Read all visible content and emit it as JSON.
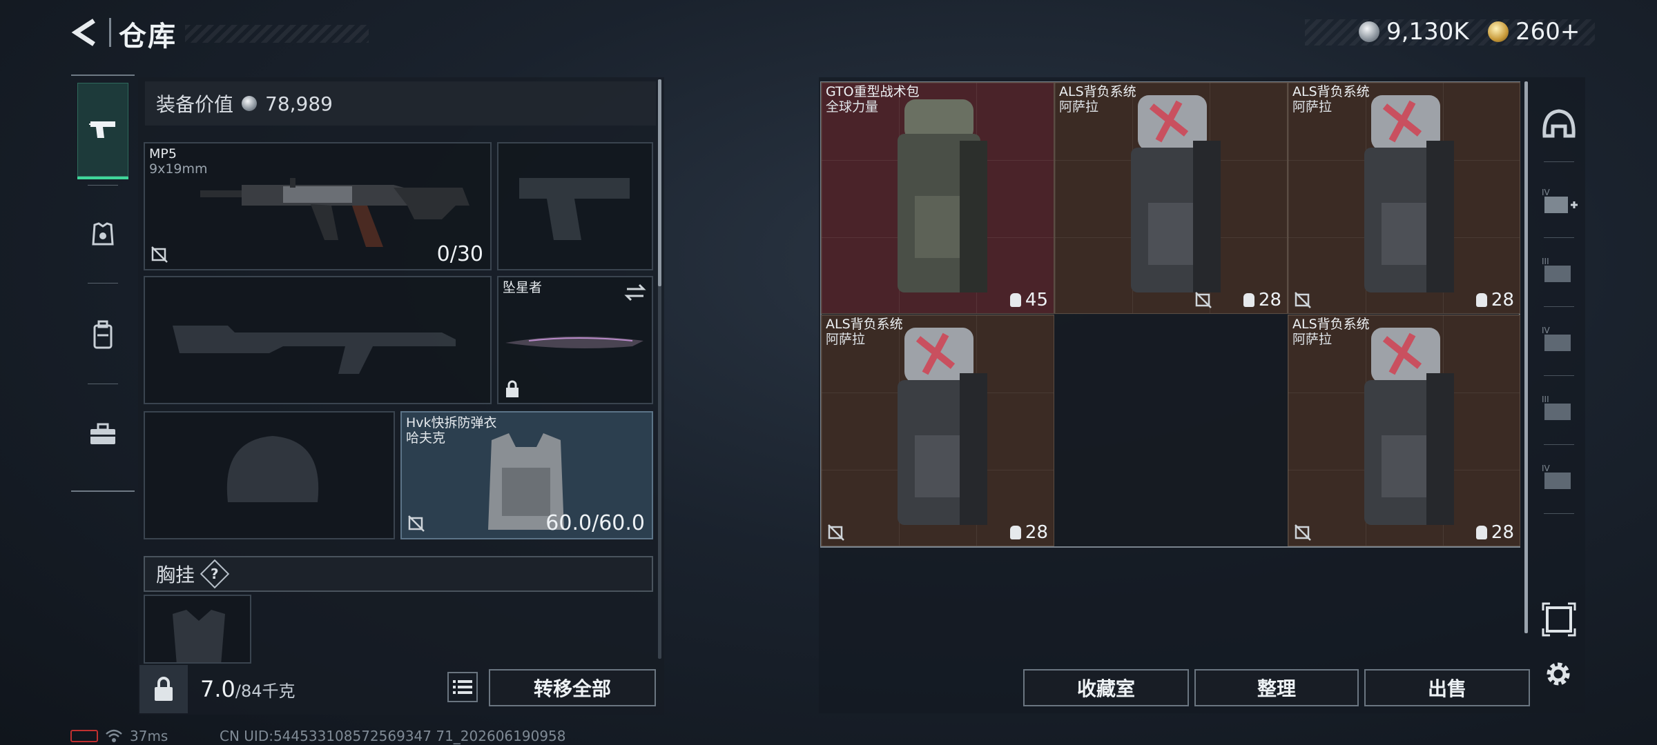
{
  "header": {
    "title": "仓库",
    "currency_primary": "9,130K",
    "currency_secondary": "260+"
  },
  "left_tabs": [
    {
      "name": "weapons",
      "icon": "pistol-icon",
      "active": true
    },
    {
      "name": "armor",
      "icon": "armor-plate-icon",
      "active": false
    },
    {
      "name": "backpack",
      "icon": "backpack-icon",
      "active": false
    },
    {
      "name": "case",
      "icon": "briefcase-icon",
      "active": false
    }
  ],
  "equipment": {
    "value_label": "装备价值",
    "value": "78,989",
    "primary_weapon": {
      "name": "MP5",
      "caliber": "9x19mm",
      "ammo": "0/30"
    },
    "melee": {
      "name": "坠星者"
    },
    "armor": {
      "name": "Hvk快拆防弹衣",
      "maker": "哈夫克",
      "durability": "60.0/60.0"
    },
    "chest_rig_label": "胸挂",
    "chest_rig_help": "?"
  },
  "footer_left": {
    "weight": "7.0",
    "weight_cap": "/84千克",
    "transfer_all": "转移全部"
  },
  "status": {
    "ping": "37ms",
    "uid": "CN UID:544533108572569347 71_202606190958"
  },
  "stash": {
    "items": [
      {
        "name": "GTO重型战术包",
        "maker": "全球力量",
        "capacity": "45",
        "tint": "red",
        "insured": true
      },
      {
        "name": "ALS背负系统",
        "maker": "阿萨拉",
        "capacity": "28",
        "tint": "brown",
        "insured": false
      },
      {
        "name": "ALS背负系统",
        "maker": "阿萨拉",
        "capacity": "28",
        "tint": "brown",
        "insured": false
      },
      {
        "name": "ALS背负系统",
        "maker": "阿萨拉",
        "capacity": "28",
        "tint": "brown",
        "insured": false
      },
      {
        "name": "ALS背负系统",
        "maker": "阿萨拉",
        "capacity": "28",
        "tint": "brown",
        "insured": false
      }
    ]
  },
  "buttons": {
    "collection": "收藏室",
    "sort": "整理",
    "sell": "出售"
  },
  "right_tabs": [
    "helmet-icon",
    "add-armor-iv-icon",
    "armor-iii-icon",
    "rig-iv-icon",
    "rig-iii-icon",
    "backpack-iv-icon",
    "stash-frame-icon"
  ],
  "colors": {
    "accent_active": "#3fd79a",
    "item_red": "#4a2329",
    "item_brown": "#3b2b24"
  }
}
